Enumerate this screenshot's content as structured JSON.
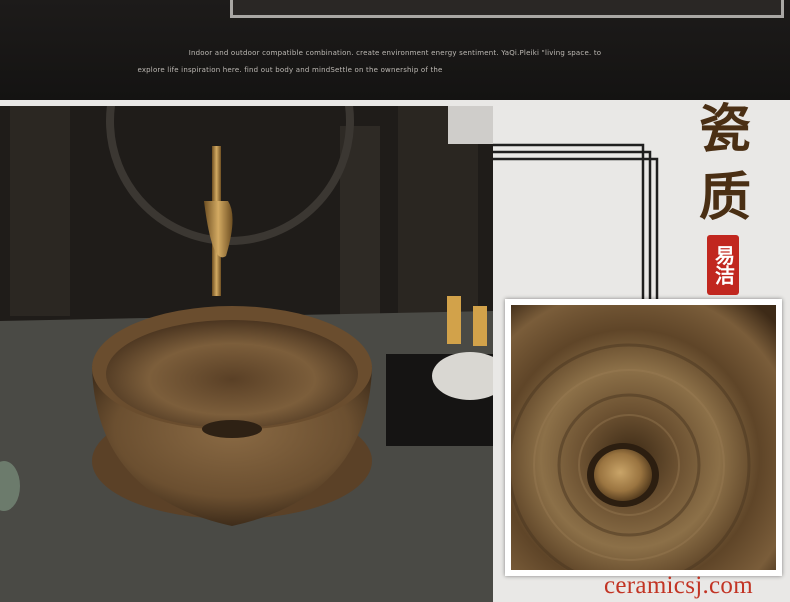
{
  "banner": {
    "line1": "Indoor and outdoor compatible combination. create environment  energy sentiment. YaQi.Pleiki \"living space. to",
    "line2": "explore life inspiration here. find out body and mindSettle on the ownership of the"
  },
  "title": {
    "char1": "瓷",
    "char2": "质",
    "seal": "易洁"
  },
  "watermark": "ceramicsj.com",
  "colors": {
    "banner_bg": "#1d1b1a",
    "title_brown": "#4a2f14",
    "seal_red": "#c1271f",
    "watermark_red": "#c23424"
  }
}
